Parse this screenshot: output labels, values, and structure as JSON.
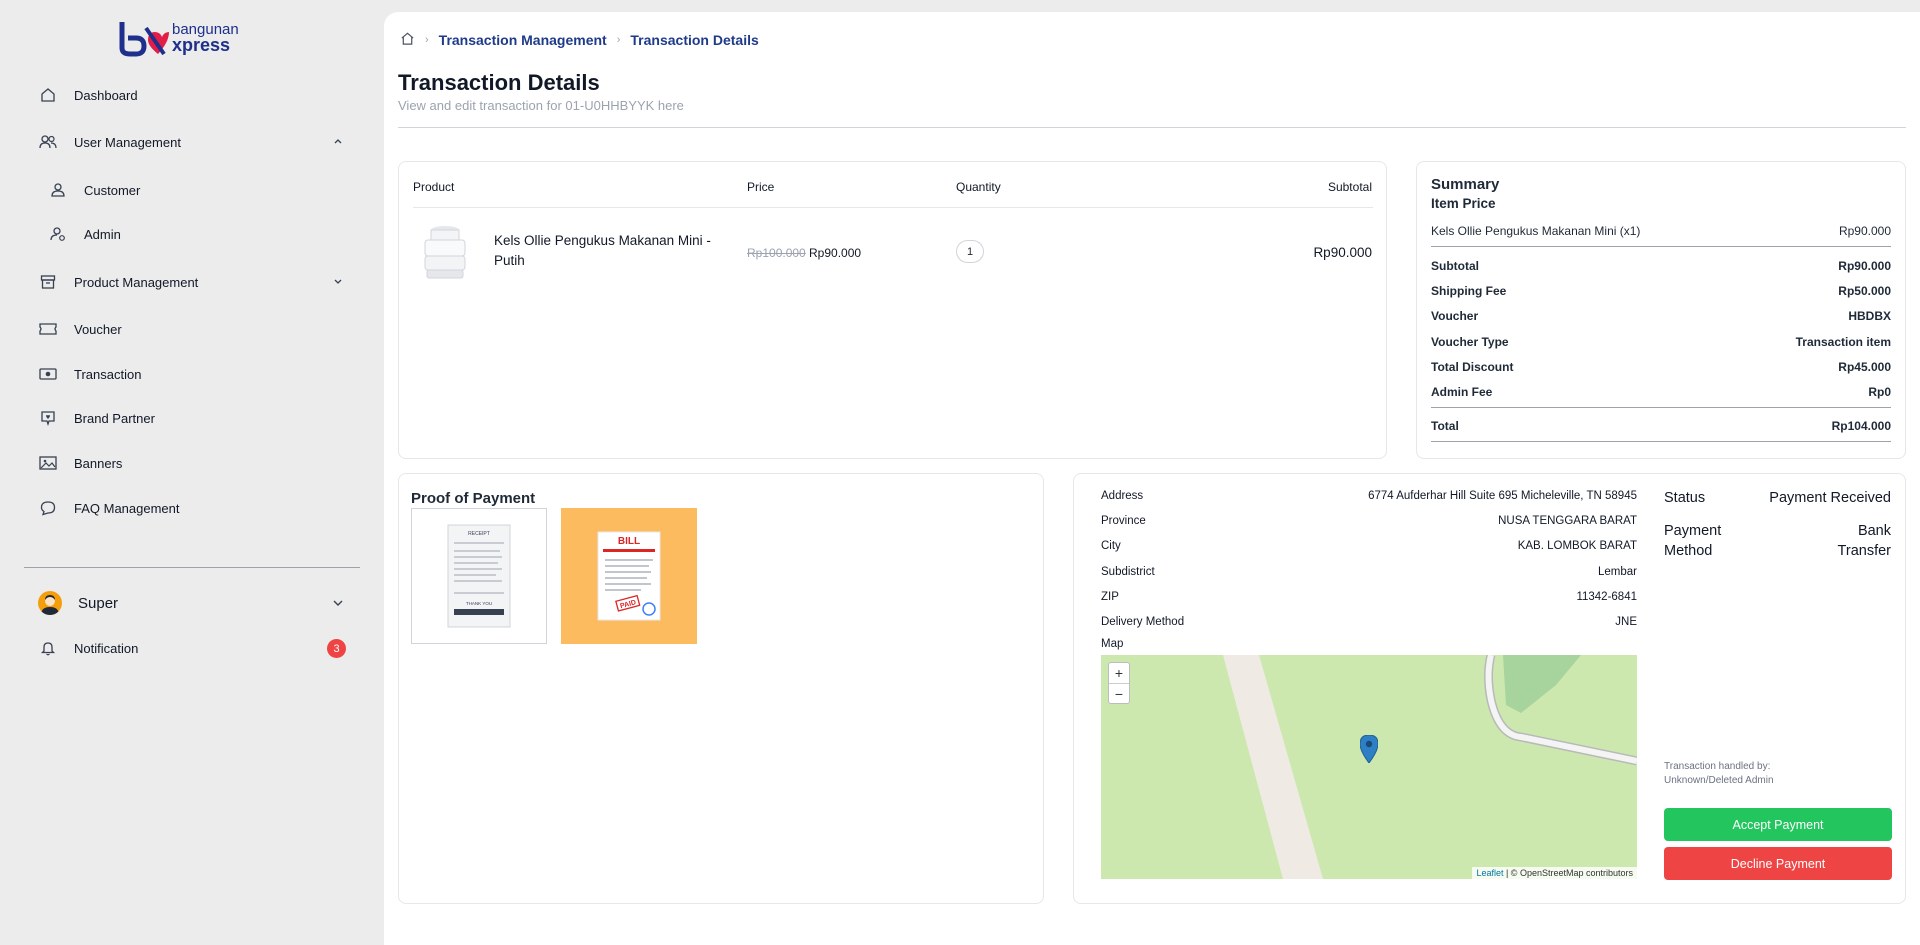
{
  "brand": {
    "line1": "bangunan",
    "line2": "xpress"
  },
  "sidebar": {
    "items": [
      {
        "label": "Dashboard",
        "icon": "home-icon"
      },
      {
        "label": "User Management",
        "icon": "users-icon"
      },
      {
        "label": "Customer",
        "icon": "user-icon"
      },
      {
        "label": "Admin",
        "icon": "user-gear-icon"
      },
      {
        "label": "Product Management",
        "icon": "archive-icon"
      },
      {
        "label": "Voucher",
        "icon": "ticket-icon"
      },
      {
        "label": "Transaction",
        "icon": "cash-icon"
      },
      {
        "label": "Brand Partner",
        "icon": "badge-icon"
      },
      {
        "label": "Banners",
        "icon": "image-icon"
      },
      {
        "label": "FAQ Management",
        "icon": "chat-icon"
      }
    ],
    "user_name": "Super",
    "notification_label": "Notification",
    "notification_count": "3"
  },
  "breadcrumb": {
    "level1": "Transaction Management",
    "level2": "Transaction Details"
  },
  "page": {
    "title": "Transaction Details",
    "subtitle": "View and edit transaction for 01-U0HHBYYK here"
  },
  "products": {
    "headers": {
      "product": "Product",
      "price": "Price",
      "quantity": "Quantity",
      "subtotal": "Subtotal"
    },
    "rows": [
      {
        "name": "Kels Ollie Pengukus Makanan Mini - Putih",
        "price_old": "Rp100.000",
        "price_new": "Rp90.000",
        "quantity": "1",
        "subtotal": "Rp90.000"
      }
    ]
  },
  "summary": {
    "title": "Summary",
    "item_price_label": "Item Price",
    "item_name": "Kels Ollie Pengukus Makanan Mini (x1)",
    "item_price": "Rp90.000",
    "subtotal_label": "Subtotal",
    "subtotal": "Rp90.000",
    "shipping_label": "Shipping Fee",
    "shipping": "Rp50.000",
    "voucher_label": "Voucher",
    "voucher": "HBDBX",
    "voucher_type_label": "Voucher Type",
    "voucher_type": "Transaction item",
    "discount_label": "Total Discount",
    "discount": "Rp45.000",
    "admin_fee_label": "Admin Fee",
    "admin_fee": "Rp0",
    "total_label": "Total",
    "total": "Rp104.000"
  },
  "proof": {
    "title": "Proof of Payment",
    "images": [
      {
        "name": "receipt-image",
        "heading": "RECEIPT",
        "footer": "THANK YOU"
      },
      {
        "name": "bill-image",
        "heading": "BILL",
        "stamp": "PAID"
      }
    ]
  },
  "shipping": {
    "address_label": "Address",
    "address": "6774 Aufderhar Hill Suite 695 Micheleville, TN 58945",
    "province_label": "Province",
    "province": "NUSA TENGGARA BARAT",
    "city_label": "City",
    "city": "KAB. LOMBOK BARAT",
    "subdistrict_label": "Subdistrict",
    "subdistrict": "Lembar",
    "zip_label": "ZIP",
    "zip": "11342-6841",
    "delivery_label": "Delivery Method",
    "delivery": "JNE",
    "map_label": "Map",
    "map_zoom_in": "+",
    "map_zoom_out": "−",
    "map_attrib_leaflet": "Leaflet",
    "map_attrib_rest": " | © OpenStreetMap contributors"
  },
  "status": {
    "status_label": "Status",
    "status_value": "Payment Received",
    "method_label_1": "Payment",
    "method_label_2": "Method",
    "method_value_1": "Bank",
    "method_value_2": "Transfer",
    "handled_1": "Transaction handled by:",
    "handled_2": "Unknown/Deleted Admin",
    "accept_label": "Accept Payment",
    "decline_label": "Decline Payment",
    "accept_color": "#22c55e",
    "decline_color": "#ef4444"
  }
}
